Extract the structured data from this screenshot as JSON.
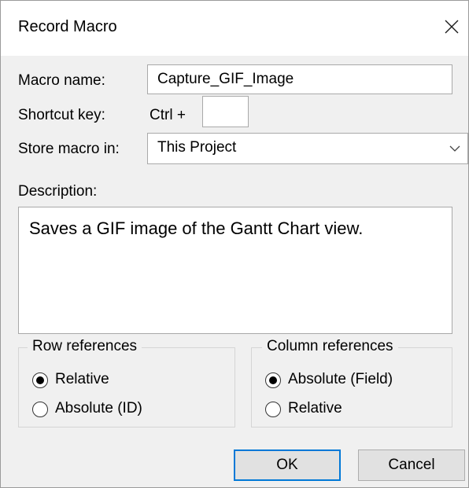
{
  "window": {
    "title": "Record Macro"
  },
  "macro_name": {
    "label": "Macro name:",
    "value": "Capture_GIF_Image"
  },
  "shortcut": {
    "label": "Shortcut key:",
    "prefix": "Ctrl  +",
    "value": ""
  },
  "store": {
    "label": "Store macro in:",
    "value": "This Project"
  },
  "description": {
    "label": "Description:",
    "value": "Saves a GIF image of the Gantt Chart view."
  },
  "row_references": {
    "title": "Row references",
    "options": [
      {
        "label": "Relative",
        "selected": true
      },
      {
        "label": "Absolute (ID)",
        "selected": false
      }
    ]
  },
  "column_references": {
    "title": "Column references",
    "options": [
      {
        "label": "Absolute (Field)",
        "selected": true
      },
      {
        "label": "Relative",
        "selected": false
      }
    ]
  },
  "buttons": {
    "ok": "OK",
    "cancel": "Cancel"
  },
  "colors": {
    "accent": "#0078d7",
    "titlebar": "#ffffff",
    "background": "#f0f0f0"
  },
  "icons": {
    "close": "close-icon",
    "dropdown": "chevron-down-icon",
    "radio": "radio-button"
  }
}
